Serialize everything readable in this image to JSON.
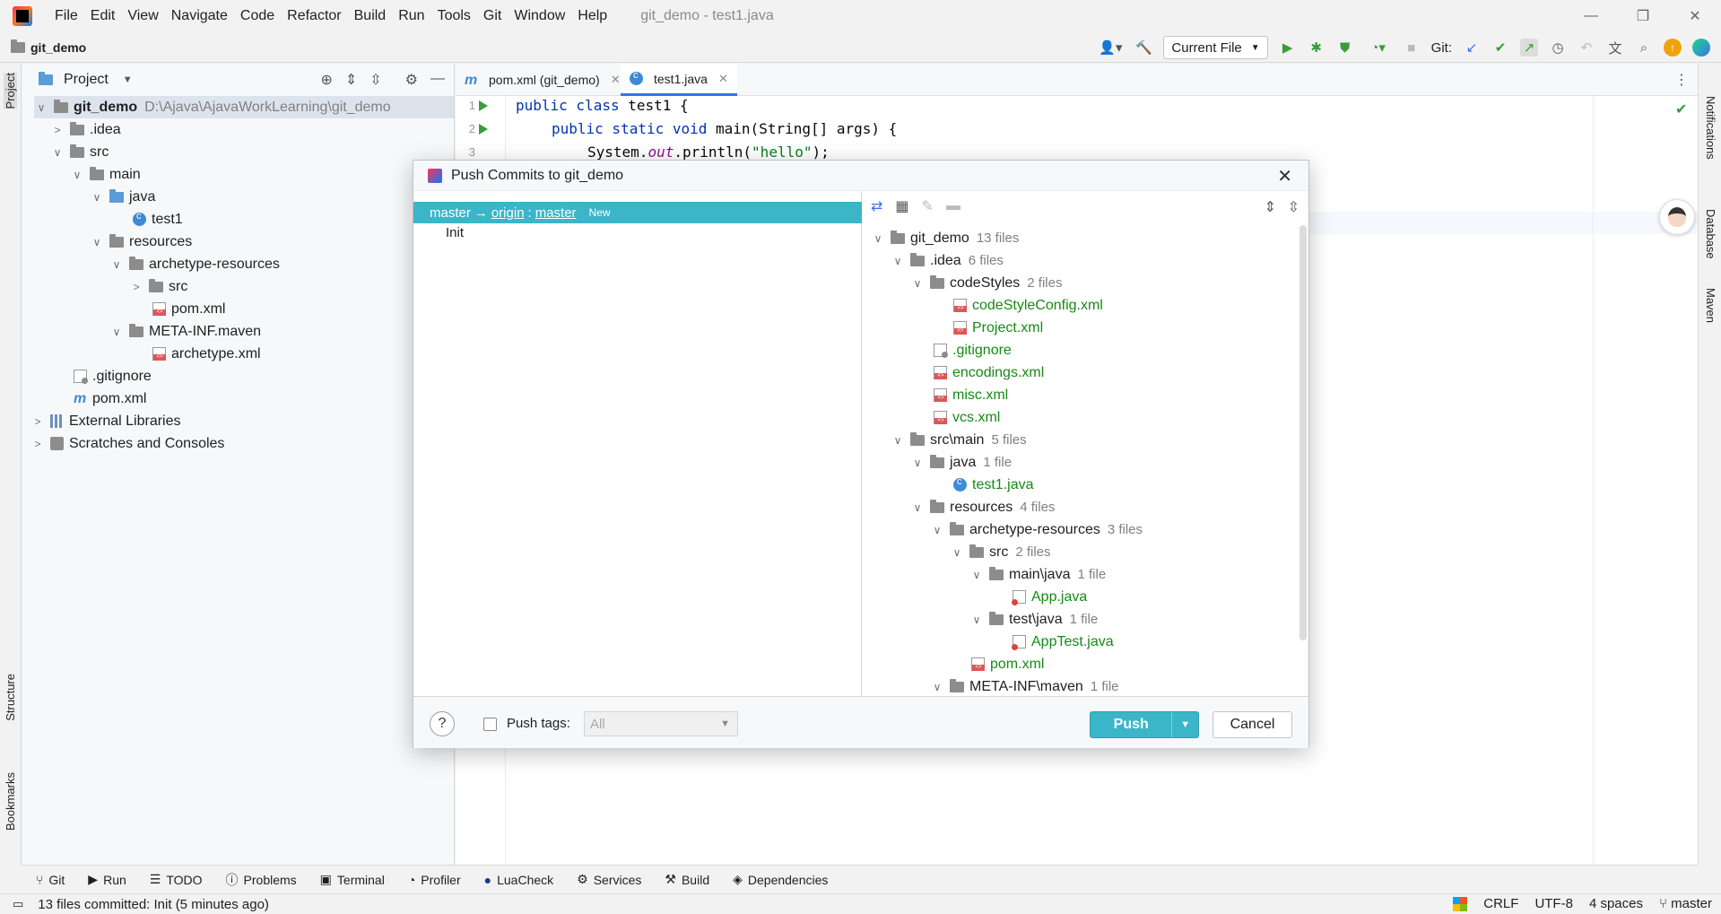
{
  "app": {
    "menu": [
      "File",
      "Edit",
      "View",
      "Navigate",
      "Code",
      "Refactor",
      "Build",
      "Run",
      "Tools",
      "Git",
      "Window",
      "Help"
    ],
    "window_title": "git_demo - test1.java"
  },
  "navbar": {
    "project_name": "git_demo",
    "run_config": "Current File",
    "git_label": "Git:"
  },
  "left_stripe": {
    "project": "Project",
    "structure": "Structure",
    "bookmarks": "Bookmarks"
  },
  "right_stripe": {
    "notifications": "Notifications",
    "database": "Database",
    "maven": "Maven"
  },
  "project_panel": {
    "title": "Project",
    "tree": [
      {
        "label": "git_demo",
        "hint": "D:\\Ajava\\AjavaWorkLearning\\git_demo"
      },
      {
        "label": ".idea"
      },
      {
        "label": "src"
      },
      {
        "label": "main"
      },
      {
        "label": "java"
      },
      {
        "label": "test1"
      },
      {
        "label": "resources"
      },
      {
        "label": "archetype-resources"
      },
      {
        "label": "src"
      },
      {
        "label": "pom.xml"
      },
      {
        "label": "META-INF.maven"
      },
      {
        "label": "archetype.xml"
      },
      {
        "label": ".gitignore"
      },
      {
        "label": "pom.xml"
      },
      {
        "label": "External Libraries"
      },
      {
        "label": "Scratches and Consoles"
      }
    ]
  },
  "editor": {
    "tabs": [
      {
        "label": "pom.xml (git_demo)"
      },
      {
        "label": "test1.java"
      }
    ],
    "lines": [
      {
        "num": "1"
      },
      {
        "num": "2"
      },
      {
        "num": "3"
      }
    ],
    "code": {
      "l1_kw": "public class",
      "l1_rest": " test1 {",
      "l2_kw": "public static void",
      "l2_rest": " main(String[] args) {",
      "l3_a": "System.",
      "l3_out": "out",
      "l3_b": ".println(",
      "l3_str": "\"hello\"",
      "l3_c": ");"
    }
  },
  "dialog": {
    "title": "Push Commits to git_demo",
    "branch": {
      "local": "master",
      "arrow": "→",
      "remote": "origin",
      "sep": ":",
      "remote_branch": "master",
      "badge": "New"
    },
    "commit": "Init",
    "files": [
      {
        "label": "git_demo",
        "count": "13 files"
      },
      {
        "label": ".idea",
        "count": "6 files"
      },
      {
        "label": "codeStyles",
        "count": "2 files"
      },
      {
        "label": "codeStyleConfig.xml"
      },
      {
        "label": "Project.xml"
      },
      {
        "label": ".gitignore"
      },
      {
        "label": "encodings.xml"
      },
      {
        "label": "misc.xml"
      },
      {
        "label": "vcs.xml"
      },
      {
        "label": "src\\main",
        "count": "5 files"
      },
      {
        "label": "java",
        "count": "1 file"
      },
      {
        "label": "test1.java"
      },
      {
        "label": "resources",
        "count": "4 files"
      },
      {
        "label": "archetype-resources",
        "count": "3 files"
      },
      {
        "label": "src",
        "count": "2 files"
      },
      {
        "label": "main\\java",
        "count": "1 file"
      },
      {
        "label": "App.java"
      },
      {
        "label": "test\\java",
        "count": "1 file"
      },
      {
        "label": "AppTest.java"
      },
      {
        "label": "pom.xml"
      },
      {
        "label": "META-INF\\maven",
        "count": "1 file"
      }
    ],
    "push_tags_label": "Push tags:",
    "push_tags_value": "All",
    "push_button": "Push",
    "cancel_button": "Cancel",
    "help": "?"
  },
  "tool_windows": [
    "Git",
    "Run",
    "TODO",
    "Problems",
    "Terminal",
    "Profiler",
    "LuaCheck",
    "Services",
    "Build",
    "Dependencies"
  ],
  "status": {
    "message": "13 files committed: Init (5 minutes ago)",
    "line_sep": "CRLF",
    "encoding": "UTF-8",
    "indent": "4 spaces",
    "branch": "master"
  },
  "colors": {
    "accent": "#3ab6c8",
    "green_file": "#168a16",
    "run_green": "#3a9c3a"
  }
}
